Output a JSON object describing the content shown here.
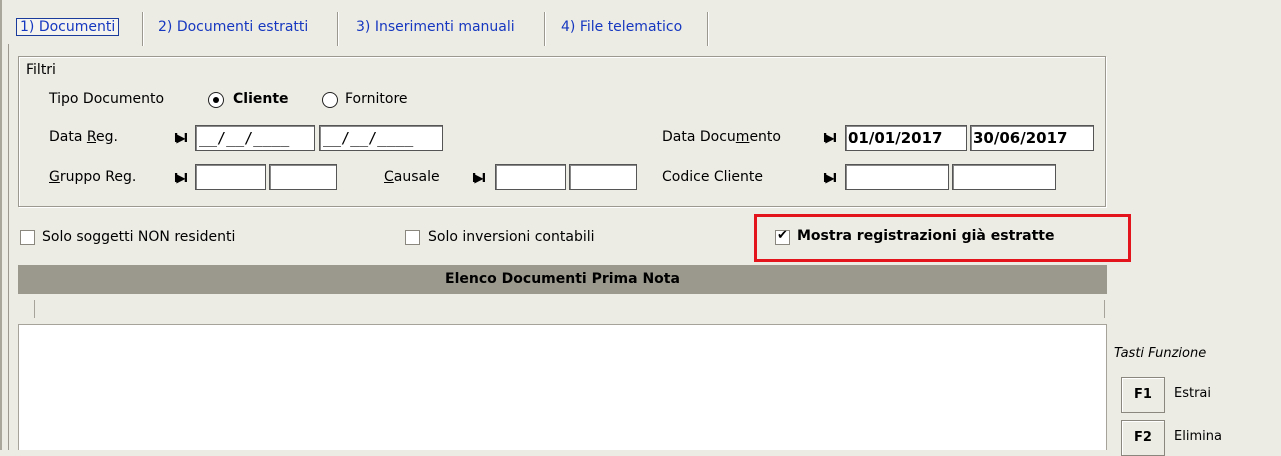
{
  "tabs": [
    {
      "label": "1) Documenti",
      "active": true
    },
    {
      "label": "2) Documenti estratti"
    },
    {
      "label": "3) Inserimenti manuali"
    },
    {
      "label": "4) File telematico"
    }
  ],
  "filters": {
    "title": "Filtri",
    "tipo_documento": {
      "label": "Tipo Documento",
      "options": [
        {
          "label": "Cliente",
          "selected": true
        },
        {
          "label": "Fornitore",
          "selected": false
        }
      ]
    },
    "data_reg": {
      "label_pre": "Data ",
      "label_u": "R",
      "label_post": "eg.",
      "from": "__/__/____",
      "to": "__/__/____"
    },
    "gruppo_reg": {
      "label_u": "G",
      "label_post": "ruppo Reg.",
      "value1": "",
      "value2": ""
    },
    "causale": {
      "label_u": "C",
      "label_post": "ausale",
      "value1": "",
      "value2": ""
    },
    "data_documento": {
      "label_pre": "Data Docu",
      "label_u": "m",
      "label_post": "ento",
      "from": "01/01/2017",
      "to": "30/06/2017"
    },
    "codice_cliente": {
      "label": "Codice Cliente",
      "value1": "",
      "value2": ""
    },
    "nav_glyph": "I▶I"
  },
  "options": {
    "solo_non_residenti": {
      "label": "Solo soggetti NON residenti",
      "checked": false
    },
    "solo_inversioni": {
      "label": "Solo inversioni contabili",
      "checked": false
    },
    "mostra_estratte": {
      "label": "Mostra registrazioni già estratte",
      "checked": true
    }
  },
  "list": {
    "title": "Elenco Documenti Prima Nota"
  },
  "function_keys": {
    "title": "Tasti Funzione",
    "keys": [
      {
        "key": "F1",
        "label": "Estrai"
      },
      {
        "key": "F2",
        "label": "Elimina"
      }
    ]
  },
  "colors": {
    "background": "#ecebe4",
    "tab_text": "#1638c0",
    "highlight": "#e4141c",
    "list_header": "#9b998e"
  }
}
